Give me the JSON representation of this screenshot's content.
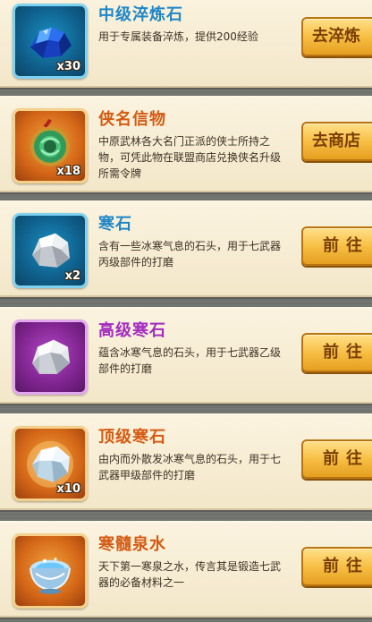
{
  "items": [
    {
      "title": "中级淬炼石",
      "title_color": "#1f86c7",
      "description": "用于专属装备淬炼，提供200经验",
      "count": "x30",
      "frame": "blue",
      "icon": "blue-crystal-ore-icon",
      "button_label": "去淬炼"
    },
    {
      "title": "侠名信物",
      "title_color": "#d55a12",
      "description": "中原武林各大名门正派的侠士所持之物，可凭此物在联盟商店兑换侠名升级所需令牌",
      "count": "x18",
      "frame": "orange",
      "icon": "jade-token-icon",
      "button_label": "去商店"
    },
    {
      "title": "寒石",
      "title_color": "#1f86c7",
      "description": "含有一些冰寒气息的石头，用于七武器丙级部件的打磨",
      "count": "x2",
      "frame": "blue",
      "icon": "cold-stone-icon",
      "button_label": "前往"
    },
    {
      "title": "高级寒石",
      "title_color": "#a32cc0",
      "description": "蕴含冰寒气息的石头，用于七武器乙级部件的打磨",
      "count": "",
      "frame": "purple",
      "icon": "cold-stone-icon",
      "button_label": "前往"
    },
    {
      "title": "顶级寒石",
      "title_color": "#d55a12",
      "description": "由内而外散发冰寒气息的石头，用于七武器甲级部件的打磨",
      "count": "x10",
      "frame": "orange",
      "icon": "ice-crystal-icon",
      "button_label": "前往"
    },
    {
      "title": "寒髓泉水",
      "title_color": "#d55a12",
      "description": "天下第一寒泉之水，传言其是锻造七武器的必备材料之一",
      "count": "",
      "frame": "orange",
      "icon": "spring-water-bowl-icon",
      "button_label": "前往"
    }
  ]
}
